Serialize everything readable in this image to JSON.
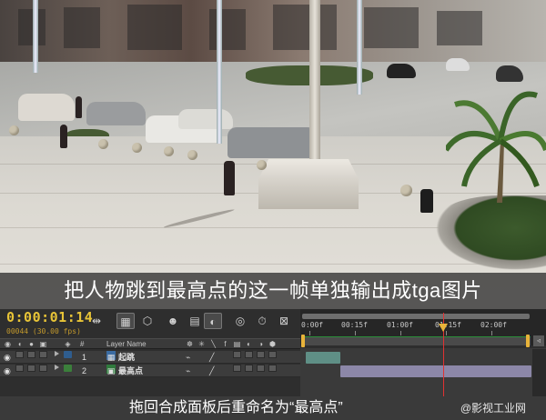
{
  "video": {
    "caption": "把人物跳到最高点的这一帧单独输出成tga图片"
  },
  "timeline": {
    "timecode": "0:00:01:14",
    "frame_info": "00044 (30.00 fps)",
    "ruler_labels": [
      "0:00f",
      "00:15f",
      "01:00f",
      "01:15f",
      "02:00f"
    ],
    "columns": {
      "source_name": "Layer Name",
      "number": "#"
    },
    "layers": [
      {
        "number": "1",
        "name": "起跳",
        "label_color": "#2f5d8e",
        "track_color": "#5f8f86"
      },
      {
        "number": "2",
        "name": "最高点",
        "label_color": "#3b7f3b",
        "track_color": "#8c87a8"
      }
    ],
    "colors": {
      "timecode": "#e8c437",
      "playhead": "#e03232",
      "work_area_handle": "#e8b33a"
    }
  },
  "tooltip": {
    "caption": "拖回合成面板后重命名为“最高点”",
    "watermark": "@影视工业网"
  },
  "icons": [
    "eye-icon",
    "audio-icon",
    "solo-icon",
    "lock-icon",
    "label-icon",
    "comp-icon",
    "playhead-icon"
  ]
}
